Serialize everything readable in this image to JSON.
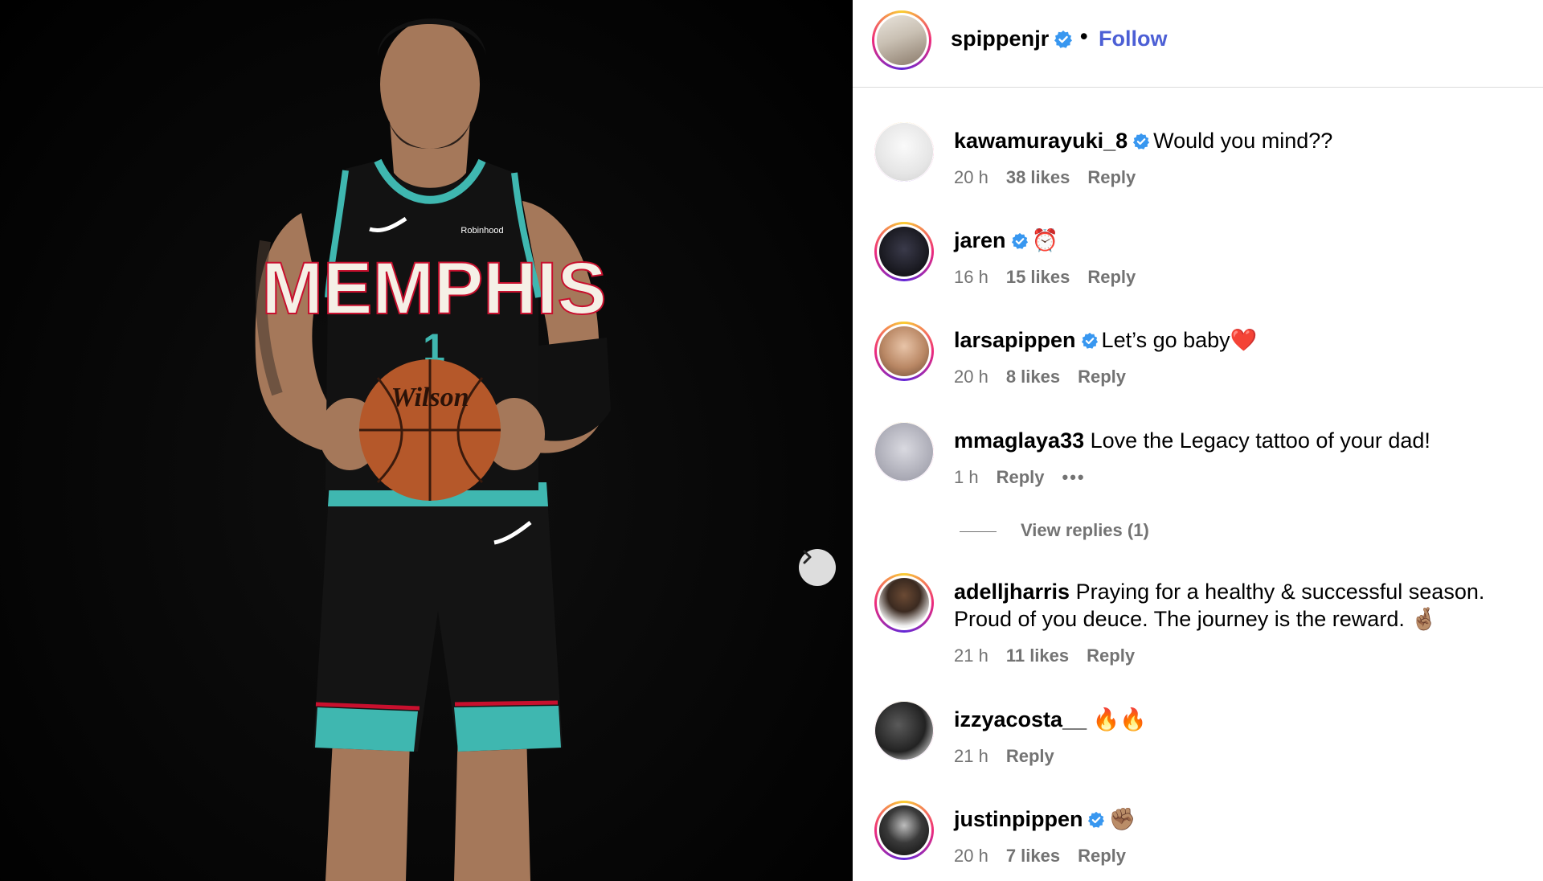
{
  "post": {
    "image_alt_colors": {
      "background": "#000000",
      "jersey": "#111111",
      "teal": "#3fb7b0",
      "red": "#c8102e"
    },
    "jersey_text": "MEMPHIS",
    "jersey_number": "1",
    "ball_brand": "Wilson",
    "sponsor": "Robinhood",
    "next_icon": "chevron-right-icon"
  },
  "header": {
    "username": "spippenjr",
    "verified": true,
    "separator": "•",
    "follow_label": "Follow"
  },
  "comments": [
    {
      "username": "kawamurayuki_8",
      "verified": true,
      "text": "Would you mind??",
      "time": "20 h",
      "likes": "38 likes",
      "reply": "Reply"
    },
    {
      "username": "jaren",
      "verified": true,
      "text": "⏰",
      "time": "16 h",
      "likes": "15 likes",
      "reply": "Reply"
    },
    {
      "username": "larsapippen",
      "verified": true,
      "text": "Let’s go baby❤️",
      "time": "20 h",
      "likes": "8 likes",
      "reply": "Reply"
    },
    {
      "username": "mmaglaya33",
      "verified": false,
      "text": "Love the Legacy tattoo of your dad!",
      "time": "1 h",
      "likes": "",
      "reply": "Reply",
      "more": "•••"
    },
    {
      "username": "adelljharris",
      "verified": false,
      "text": "Praying for a healthy & successful season. Proud of you deuce. The journey is the reward. 🤞🏽",
      "time": "21 h",
      "likes": "11 likes",
      "reply": "Reply"
    },
    {
      "username": "izzyacosta__",
      "verified": false,
      "text": "🔥🔥",
      "time": "21 h",
      "likes": "",
      "reply": "Reply"
    },
    {
      "username": "justinpippen",
      "verified": true,
      "text": "✊🏽",
      "time": "20 h",
      "likes": "7 likes",
      "reply": "Reply"
    }
  ],
  "view_replies": "View replies (1)",
  "colors": {
    "link_blue": "#4c5fd5",
    "verified_blue": "#3897f0",
    "meta_grey": "#737373"
  }
}
